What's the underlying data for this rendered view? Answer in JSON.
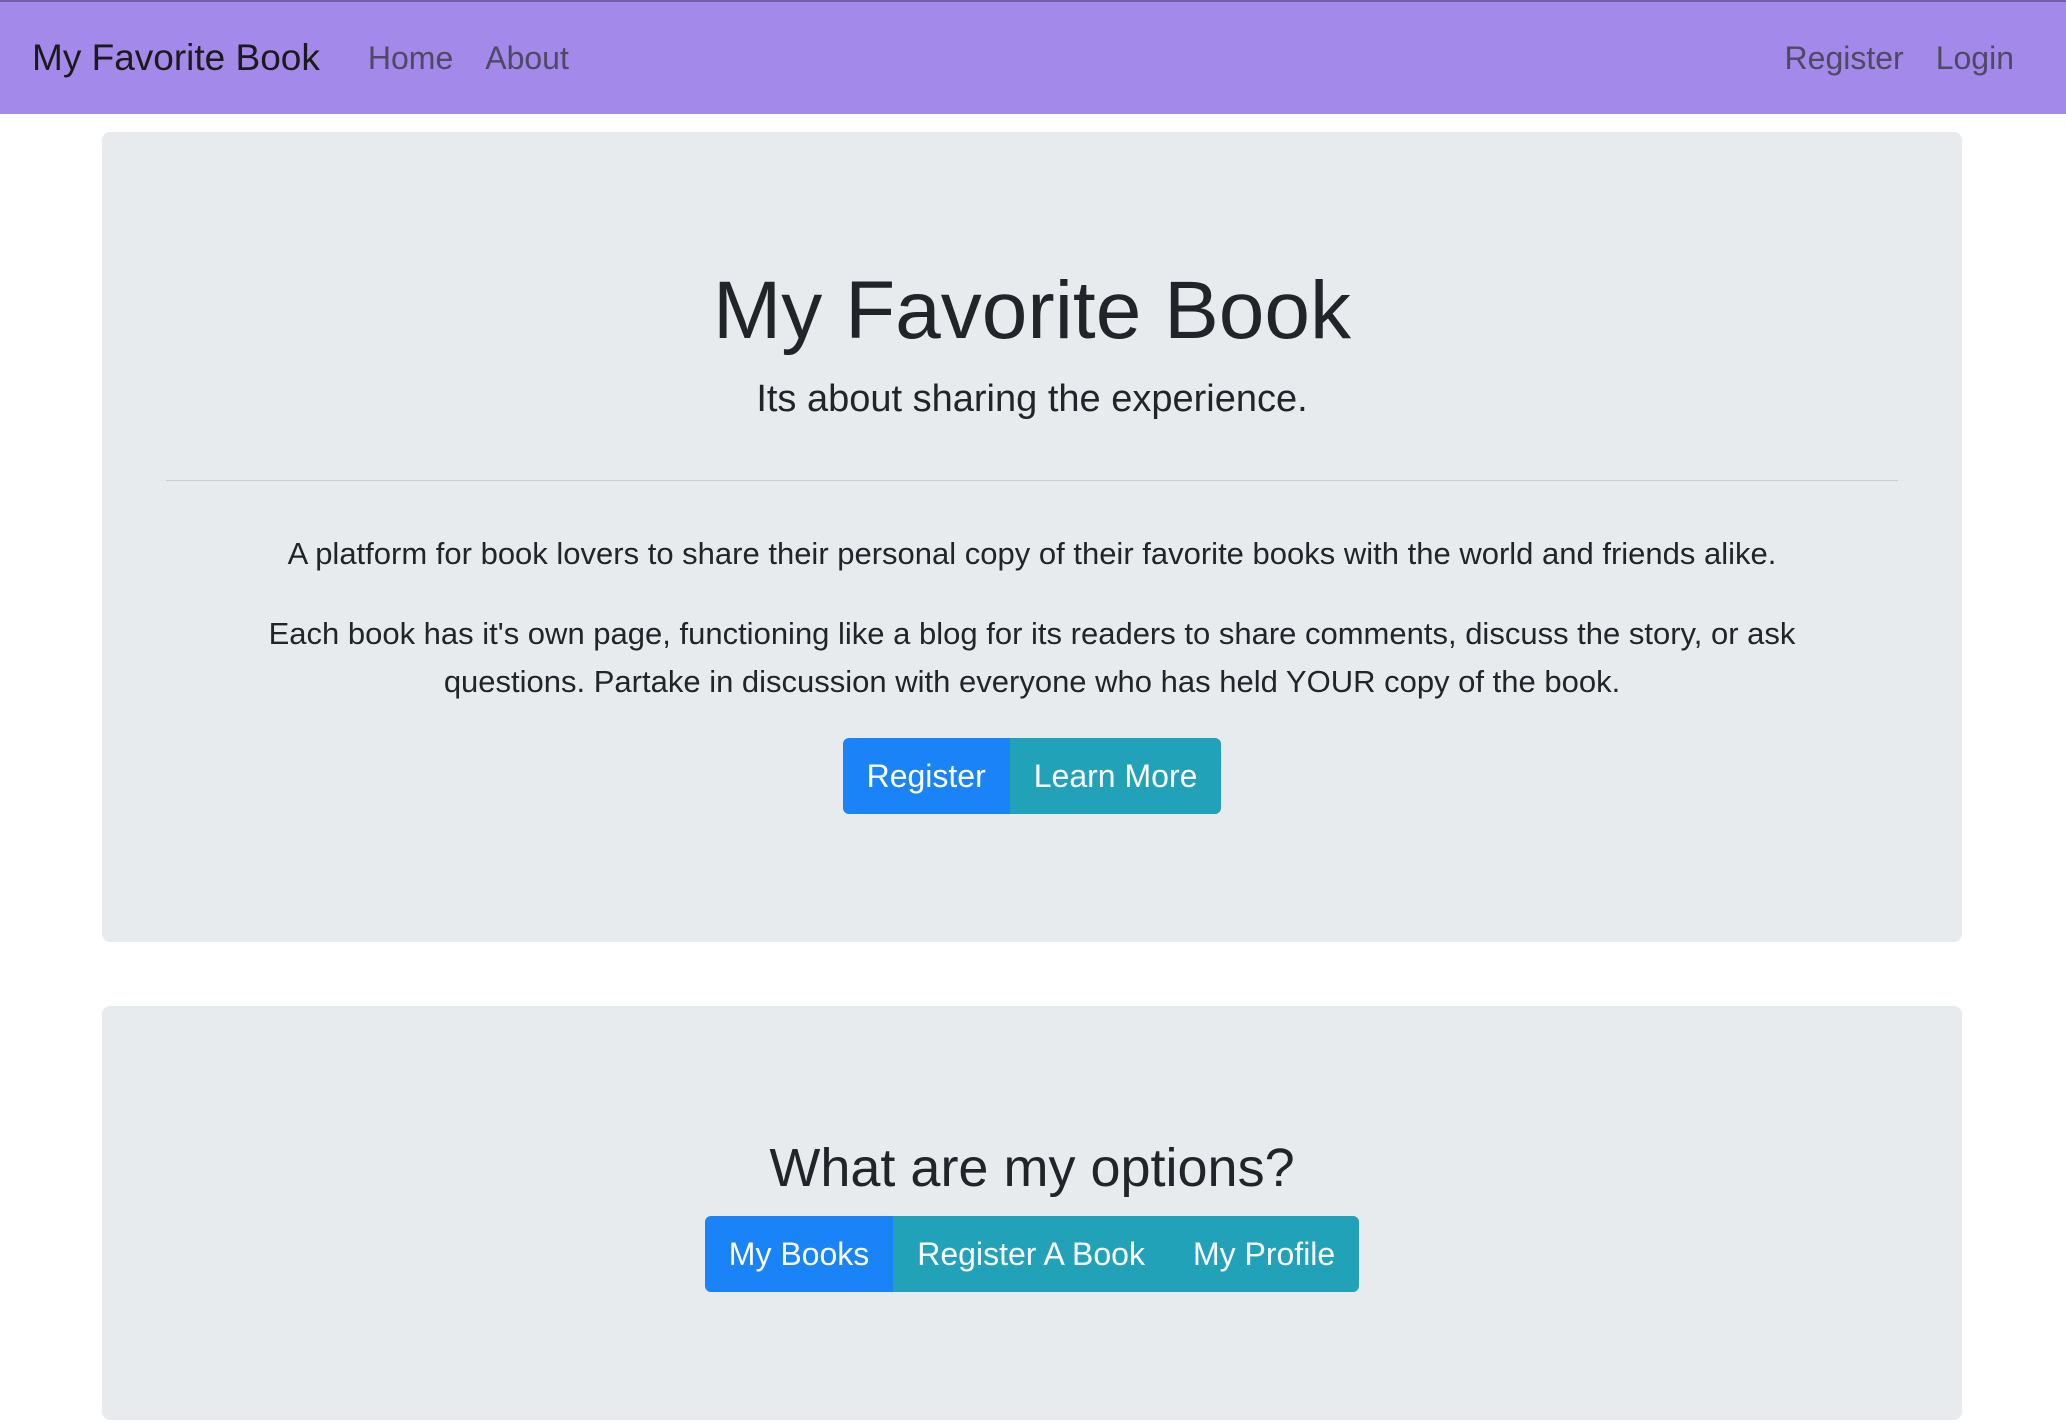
{
  "navbar": {
    "brand": "My Favorite Book",
    "left_links": [
      "Home",
      "About"
    ],
    "right_links": [
      "Register",
      "Login"
    ],
    "background_color": "#a389e9"
  },
  "hero": {
    "title": "My Favorite Book",
    "lead": "Its about sharing the experience.",
    "paragraph_1": "A platform for book lovers to share their personal copy of their favorite books with the world and friends alike.",
    "paragraph_2": "Each book has it's own page, functioning like a blog for its readers to share comments, discuss the story, or ask questions. Partake in discussion with everyone who has held YOUR copy of the book.",
    "buttons": {
      "register": "Register",
      "learn_more": "Learn More"
    }
  },
  "options": {
    "title": "What are my options?",
    "buttons": {
      "my_books": "My Books",
      "register_book": "Register A Book",
      "my_profile": "My Profile"
    }
  },
  "colors": {
    "primary": "#1a83f8",
    "info": "#22a2b8",
    "card_background": "#e8ebee"
  }
}
